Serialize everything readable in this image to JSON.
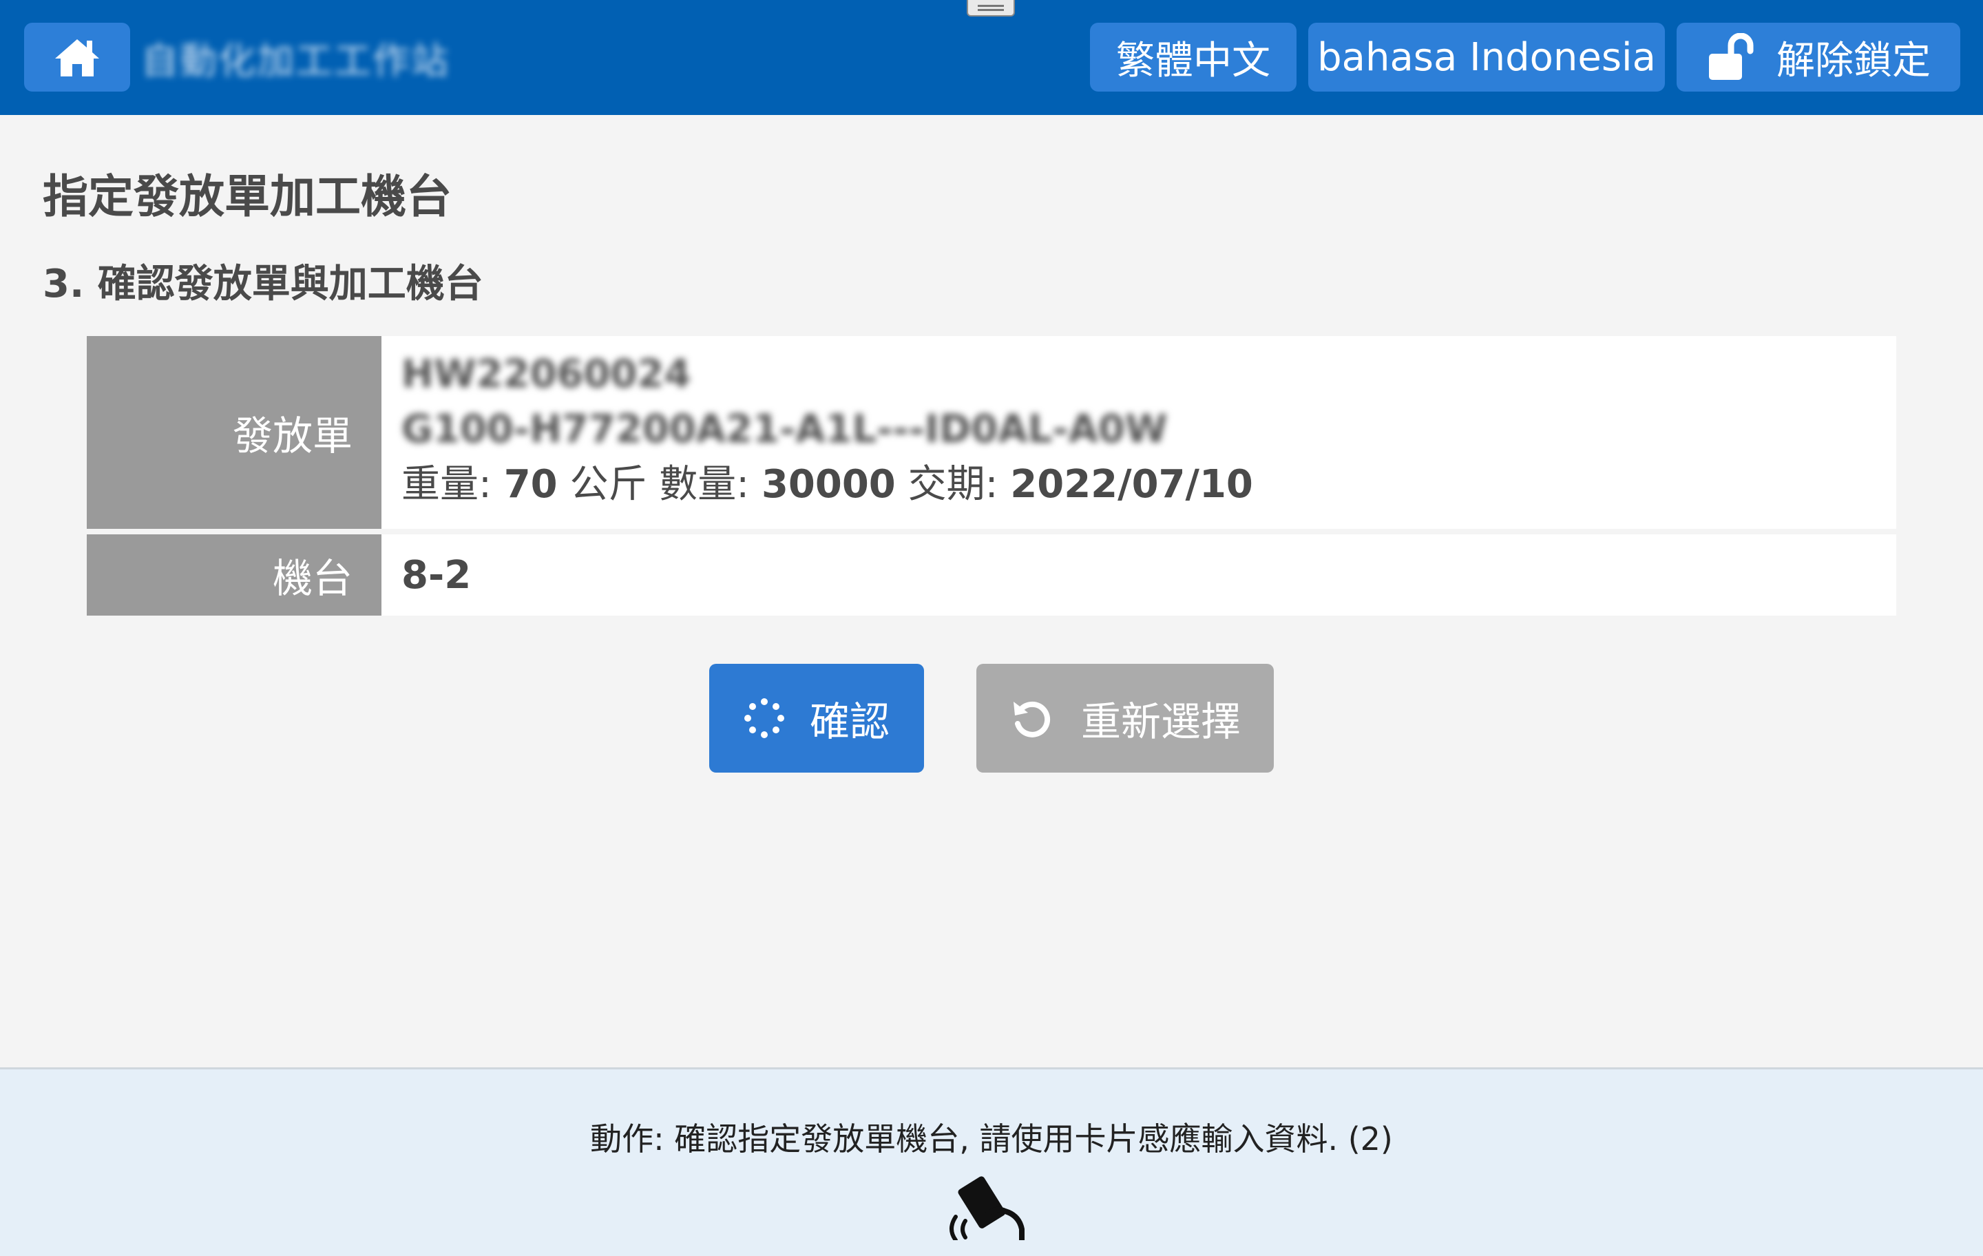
{
  "header": {
    "home_icon": "home-icon",
    "app_title": "自動化加工工作站",
    "lang_zh": "繁體中文",
    "lang_id": "bahasa Indonesia",
    "unlock_label": "解除鎖定",
    "unlock_icon": "unlocked-padlock-icon",
    "bar_color": "#0160b3",
    "button_color": "#2d7fd8"
  },
  "page": {
    "title": "指定發放單加工機台",
    "step": "3. 確認發放單與加工機台"
  },
  "order": {
    "label": "發放單",
    "order_no": "HW22060024",
    "product_code": "G100-H77200A21-A1L---ID0AL-A0W",
    "weight_label": "重量:",
    "weight_value": "70",
    "weight_unit": "公斤",
    "qty_label": "數量:",
    "qty_value": "30000",
    "due_label": "交期:",
    "due_value": "2022/07/10"
  },
  "machine": {
    "label": "機台",
    "value": "8-2"
  },
  "actions": {
    "confirm_label": "確認",
    "confirm_icon": "loading-spinner-icon",
    "reselect_label": "重新選擇",
    "reselect_icon": "undo-icon"
  },
  "footer": {
    "message": "動作: 確認指定發放單機台, 請使用卡片感應輸入資料. (2)",
    "card_icon": "tap-card-icon"
  }
}
